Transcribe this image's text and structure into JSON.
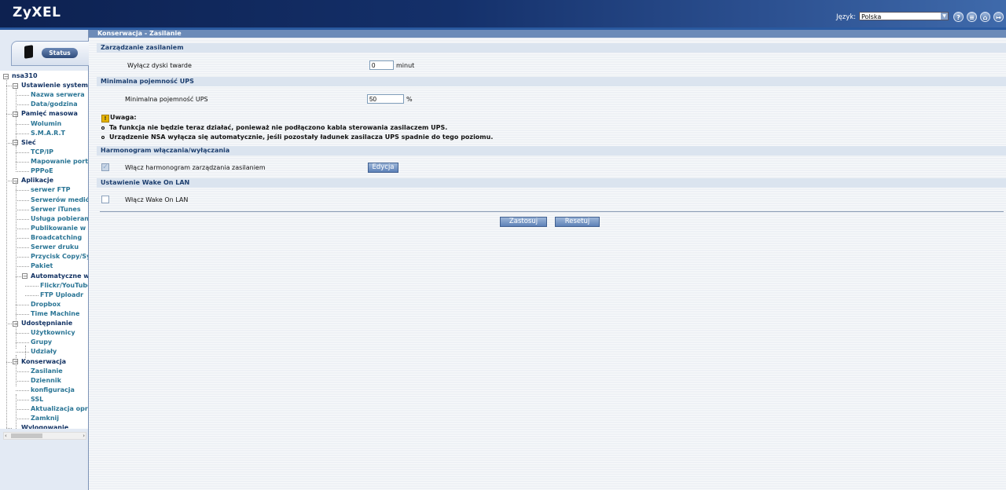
{
  "header": {
    "logo": "ZyXEL",
    "language_label": "Język:",
    "language_value": "Polska",
    "icons": [
      "help-icon",
      "list-icon",
      "home-icon",
      "logout-icon"
    ]
  },
  "sidebar": {
    "status_label": "Status",
    "tree": [
      {
        "label": "nsa310",
        "type": "root"
      },
      {
        "label": "Ustawienie systemu",
        "type": "cat"
      },
      {
        "label": "Nazwa serwera",
        "type": "leaf"
      },
      {
        "label": "Data/godzina",
        "type": "leaf"
      },
      {
        "label": "Pamięć masowa",
        "type": "cat"
      },
      {
        "label": "Wolumin",
        "type": "leaf"
      },
      {
        "label": "S.M.A.R.T",
        "type": "leaf"
      },
      {
        "label": "Sieć",
        "type": "cat"
      },
      {
        "label": "TCP/IP",
        "type": "leaf"
      },
      {
        "label": "Mapowanie portów",
        "type": "leaf"
      },
      {
        "label": "PPPoE",
        "type": "leaf"
      },
      {
        "label": "Aplikacje",
        "type": "cat"
      },
      {
        "label": "serwer FTP",
        "type": "leaf"
      },
      {
        "label": "Serwerów mediów",
        "type": "leaf"
      },
      {
        "label": "Serwer iTunes",
        "type": "leaf"
      },
      {
        "label": "Usługa pobierania",
        "type": "leaf"
      },
      {
        "label": "Publikowanie w sieci",
        "type": "leaf"
      },
      {
        "label": "Broadcatching",
        "type": "leaf"
      },
      {
        "label": "Serwer druku",
        "type": "leaf"
      },
      {
        "label": "Przycisk Copy/Sync",
        "type": "leaf"
      },
      {
        "label": "Pakiet",
        "type": "leaf"
      },
      {
        "label": "Automatyczne wysyłanie",
        "type": "subcat"
      },
      {
        "label": "Flickr/YouTube",
        "type": "leaf2"
      },
      {
        "label": "FTP Uploadr",
        "type": "leaf2"
      },
      {
        "label": "Dropbox",
        "type": "leaf"
      },
      {
        "label": "Time Machine",
        "type": "leaf"
      },
      {
        "label": "Udostępnianie",
        "type": "cat"
      },
      {
        "label": "Użytkownicy",
        "type": "leaf"
      },
      {
        "label": "Grupy",
        "type": "leaf"
      },
      {
        "label": "Udziały",
        "type": "leaf"
      },
      {
        "label": "Konserwacja",
        "type": "cat"
      },
      {
        "label": "Zasilanie",
        "type": "leaf"
      },
      {
        "label": "Dziennik",
        "type": "leaf"
      },
      {
        "label": "konfiguracja",
        "type": "leaf"
      },
      {
        "label": "SSL",
        "type": "leaf"
      },
      {
        "label": "Aktualizacja oprogramowania",
        "type": "leaf"
      },
      {
        "label": "Zamknij",
        "type": "leaf"
      },
      {
        "label": "Wylogowanie",
        "type": "catleaf"
      }
    ]
  },
  "main": {
    "page_title": "Konserwacja - Zasilanie",
    "power_section": "Zarządzanie zasilaniem",
    "disk_label": "Wyłącz dyski twarde",
    "disk_value": "0",
    "disk_unit": "minut",
    "ups_section": "Minimalna pojemność UPS",
    "ups_label": "Minimalna pojemność UPS",
    "ups_value": "50",
    "ups_unit": "%",
    "note_title": "Uwaga:",
    "notes": [
      "Ta funkcja nie będzie teraz działać, ponieważ nie podłączono kabla sterowania zasilaczem UPS.",
      "Urządzenie NSA wyłącza się automatycznie, jeśli pozostały ładunek zasilacza UPS spadnie do tego poziomu."
    ],
    "schedule_section": "Harmonogram włączania/wyłączania",
    "schedule_label": "Włącz harmonogram zarządzania zasilaniem",
    "schedule_checked": true,
    "edit_button": "Edycja",
    "wol_section": "Ustawienie Wake On LAN",
    "wol_label": "Włącz Wake On LAN",
    "wol_checked": false,
    "apply_button": "Zastosuj",
    "reset_button": "Resetuj"
  }
}
